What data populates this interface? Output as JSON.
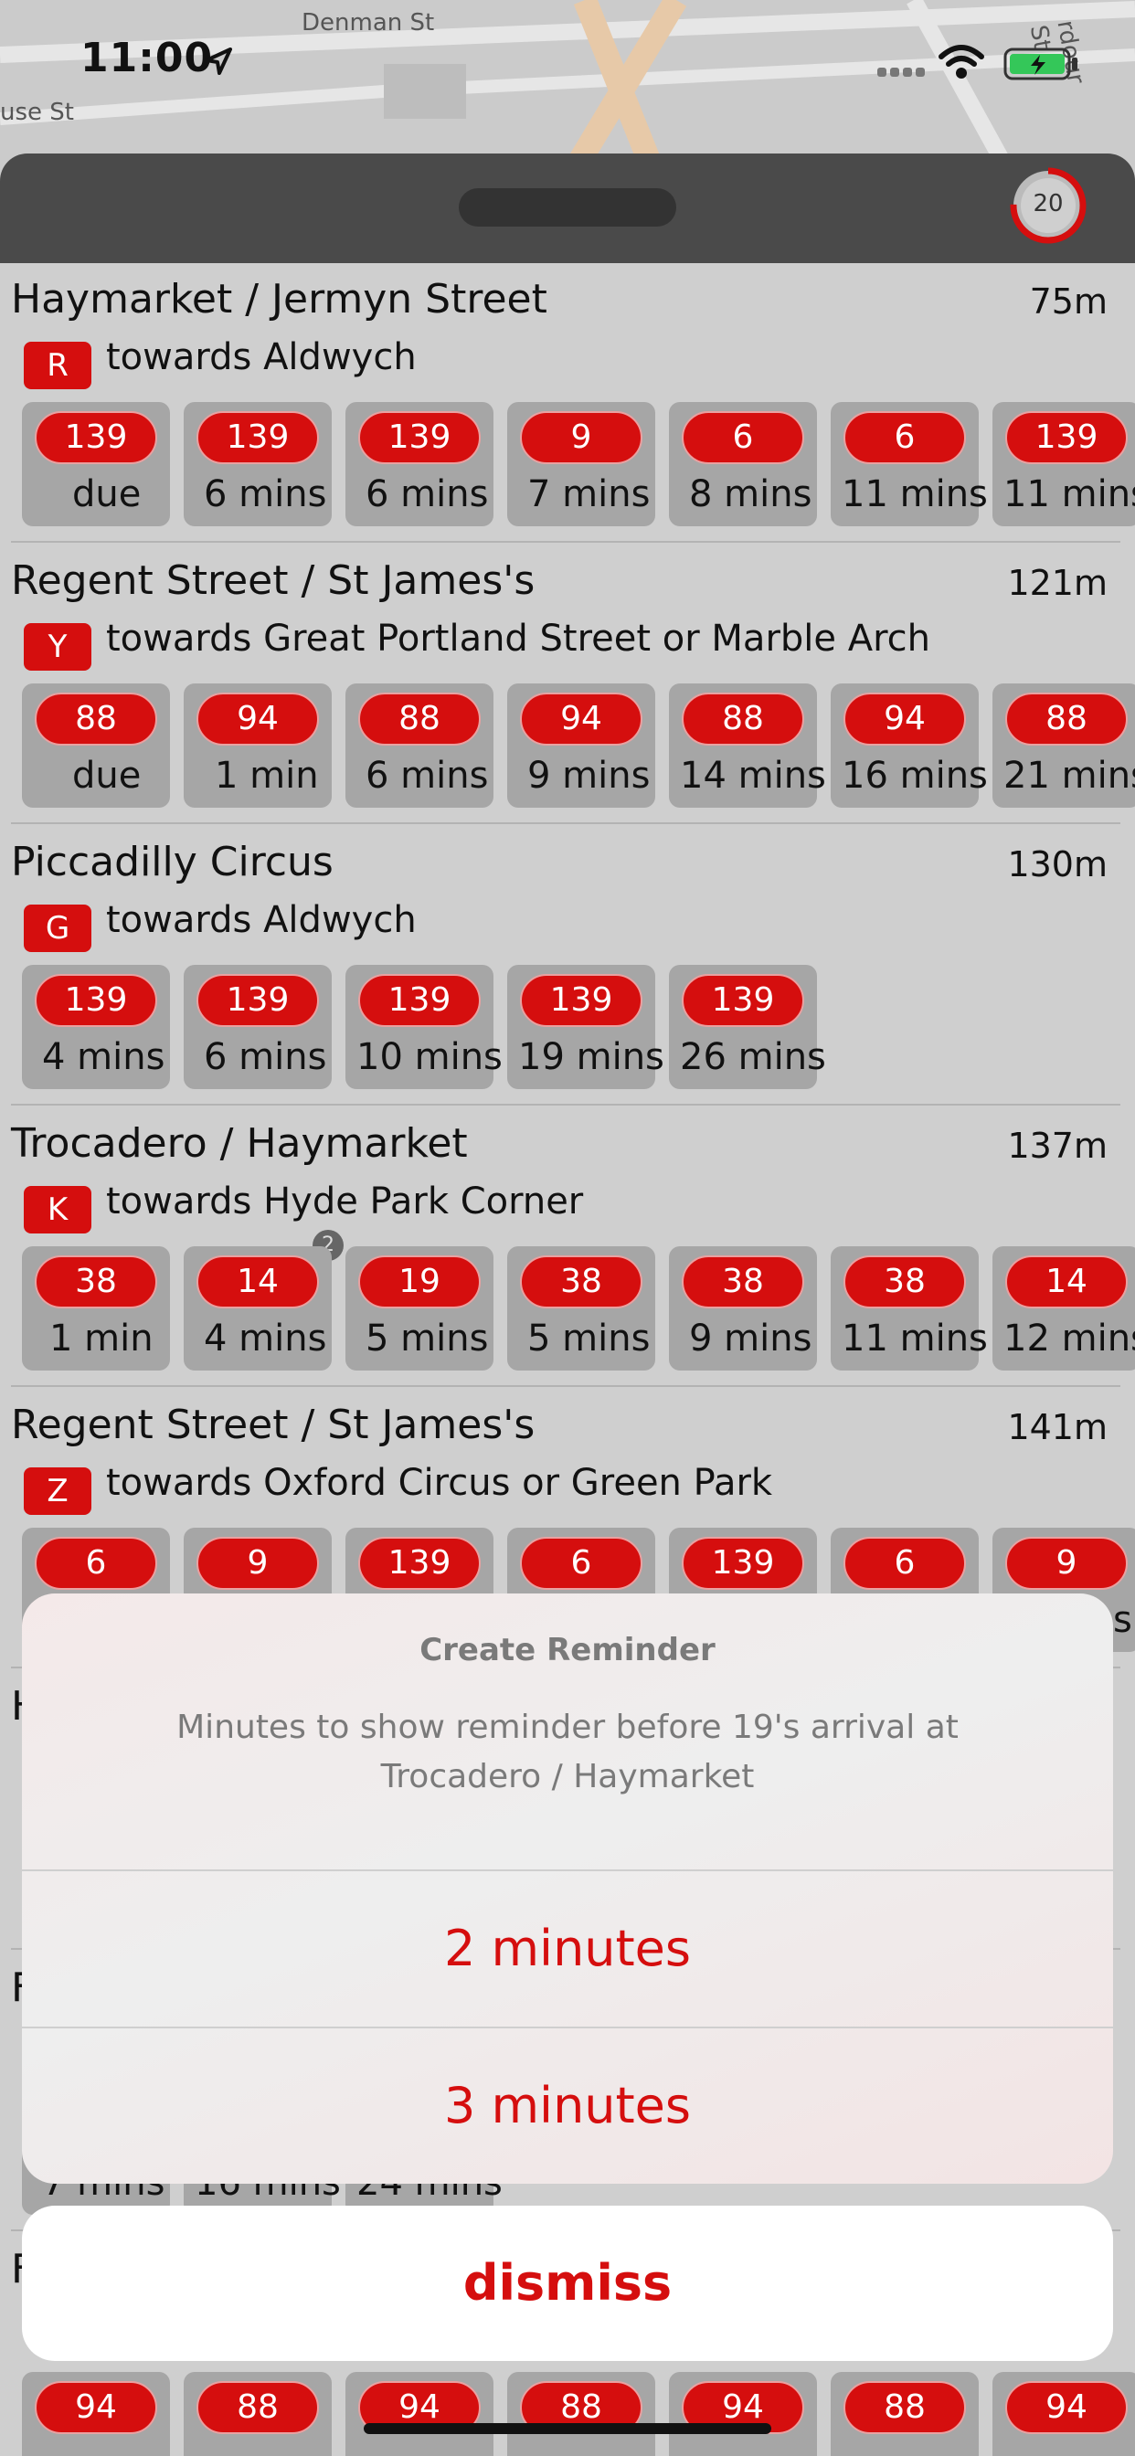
{
  "status_bar": {
    "time": "11:00"
  },
  "map": {
    "streets": [
      "Denman St",
      "use St",
      "rdour St"
    ]
  },
  "refresh": {
    "seconds": "20"
  },
  "stops": [
    {
      "name": "Haymarket / Jermyn Street",
      "distance": "75m",
      "letter": "R",
      "towards": "towards Aldwych",
      "arrivals": [
        {
          "route": "139",
          "eta": "due"
        },
        {
          "route": "139",
          "eta": "6 mins"
        },
        {
          "route": "139",
          "eta": "6 mins"
        },
        {
          "route": "9",
          "eta": "7 mins"
        },
        {
          "route": "6",
          "eta": "8 mins"
        },
        {
          "route": "6",
          "eta": "11 mins"
        },
        {
          "route": "139",
          "eta": "11 mins"
        }
      ]
    },
    {
      "name": "Regent Street / St James's",
      "distance": "121m",
      "letter": "Y",
      "towards": "towards Great Portland Street or Marble Arch",
      "arrivals": [
        {
          "route": "88",
          "eta": "due"
        },
        {
          "route": "94",
          "eta": "1 min"
        },
        {
          "route": "88",
          "eta": "6 mins"
        },
        {
          "route": "94",
          "eta": "9 mins"
        },
        {
          "route": "88",
          "eta": "14 mins"
        },
        {
          "route": "94",
          "eta": "16 mins"
        },
        {
          "route": "88",
          "eta": "21 mins"
        }
      ]
    },
    {
      "name": "Piccadilly Circus",
      "distance": "130m",
      "letter": "G",
      "towards": "towards Aldwych",
      "arrivals": [
        {
          "route": "139",
          "eta": "4 mins"
        },
        {
          "route": "139",
          "eta": "6 mins"
        },
        {
          "route": "139",
          "eta": "10 mins"
        },
        {
          "route": "139",
          "eta": "19 mins"
        },
        {
          "route": "139",
          "eta": "26 mins"
        }
      ]
    },
    {
      "name": "Trocadero / Haymarket",
      "distance": "137m",
      "letter": "K",
      "towards": "towards Hyde Park Corner",
      "badge": "2",
      "arrivals": [
        {
          "route": "38",
          "eta": "1 min"
        },
        {
          "route": "14",
          "eta": "4 mins"
        },
        {
          "route": "19",
          "eta": "5 mins"
        },
        {
          "route": "38",
          "eta": "5 mins"
        },
        {
          "route": "38",
          "eta": "9 mins"
        },
        {
          "route": "38",
          "eta": "11 mins"
        },
        {
          "route": "14",
          "eta": "12 mins"
        }
      ]
    },
    {
      "name": "Regent Street / St James's",
      "distance": "141m",
      "letter": "Z",
      "towards": "towards Oxford Circus or Green Park",
      "arrivals": [
        {
          "route": "6",
          "eta": ""
        },
        {
          "route": "9",
          "eta": ""
        },
        {
          "route": "139",
          "eta": ""
        },
        {
          "route": "6",
          "eta": ""
        },
        {
          "route": "139",
          "eta": ""
        },
        {
          "route": "6",
          "eta": ""
        },
        {
          "route": "9",
          "eta": "s"
        }
      ]
    },
    {
      "name": "H",
      "distance": "",
      "letter": "",
      "towards": "",
      "arrivals": []
    },
    {
      "name": "F",
      "distance": "",
      "letter": "",
      "towards": "",
      "arrivals": [
        {
          "route": "",
          "eta": "7 mins"
        },
        {
          "route": "",
          "eta": "16 mins"
        },
        {
          "route": "",
          "eta": "24 mins"
        }
      ]
    },
    {
      "name": "F",
      "distance": "",
      "letter": "",
      "towards": "",
      "arrivals": [
        {
          "route": "94",
          "eta": ""
        },
        {
          "route": "88",
          "eta": ""
        },
        {
          "route": "94",
          "eta": ""
        },
        {
          "route": "88",
          "eta": ""
        },
        {
          "route": "94",
          "eta": ""
        },
        {
          "route": "88",
          "eta": ""
        },
        {
          "route": "94",
          "eta": ""
        }
      ]
    }
  ],
  "reminder_sheet": {
    "title": "Create Reminder",
    "message": "Minutes to show reminder before 19's arrival at Trocadero / Haymarket",
    "options": [
      "2 minutes",
      "3 minutes"
    ],
    "dismiss": "dismiss"
  },
  "colors": {
    "accent": "#d50e0e",
    "header": "#4a4a4a",
    "tile": "#a6a6a6"
  }
}
